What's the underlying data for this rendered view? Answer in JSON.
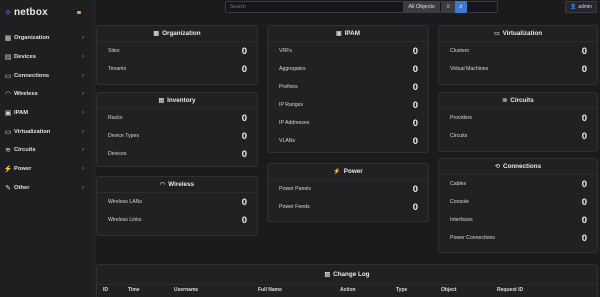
{
  "brand": {
    "name": "netbox"
  },
  "sidebar": {
    "items": [
      {
        "label": "Organization",
        "icon": "building-icon",
        "glyph": "▦"
      },
      {
        "label": "Devices",
        "icon": "server-icon",
        "glyph": "▤"
      },
      {
        "label": "Connections",
        "icon": "ethernet-icon",
        "glyph": "▭"
      },
      {
        "label": "Wireless",
        "icon": "wifi-icon",
        "glyph": "◠"
      },
      {
        "label": "IPAM",
        "icon": "counter-icon",
        "glyph": "▣"
      },
      {
        "label": "Virtualization",
        "icon": "monitor-icon",
        "glyph": "▭"
      },
      {
        "label": "Circuits",
        "icon": "transit-icon",
        "glyph": "≋"
      },
      {
        "label": "Power",
        "icon": "bolt-icon",
        "glyph": "⚡"
      },
      {
        "label": "Other",
        "icon": "notebook-icon",
        "glyph": "✎"
      }
    ]
  },
  "search": {
    "placeholder": "Search",
    "scope": "All Objects"
  },
  "user": {
    "name": "admin"
  },
  "cards": {
    "organization": {
      "title": "Organization",
      "rows": [
        {
          "label": "Sites",
          "value": "0"
        },
        {
          "label": "Tenants",
          "value": "0"
        }
      ]
    },
    "ipam": {
      "title": "IPAM",
      "rows": [
        {
          "label": "VRFs",
          "value": "0"
        },
        {
          "label": "Aggregates",
          "value": "0"
        },
        {
          "label": "Prefixes",
          "value": "0"
        },
        {
          "label": "IP Ranges",
          "value": "0"
        },
        {
          "label": "IP Addresses",
          "value": "0"
        },
        {
          "label": "VLANs",
          "value": "0"
        }
      ]
    },
    "virtualization": {
      "title": "Virtualization",
      "rows": [
        {
          "label": "Clusters",
          "value": "0"
        },
        {
          "label": "Virtual Machines",
          "value": "0"
        }
      ]
    },
    "inventory": {
      "title": "Inventory",
      "rows": [
        {
          "label": "Racks",
          "value": "0"
        },
        {
          "label": "Device Types",
          "value": "0"
        },
        {
          "label": "Devices",
          "value": "0"
        }
      ]
    },
    "circuits": {
      "title": "Circuits",
      "rows": [
        {
          "label": "Providers",
          "value": "0"
        },
        {
          "label": "Circuits",
          "value": "0"
        }
      ]
    },
    "power": {
      "title": "Power",
      "rows": [
        {
          "label": "Power Panels",
          "value": "0"
        },
        {
          "label": "Power Feeds",
          "value": "0"
        }
      ]
    },
    "connections": {
      "title": "Connections",
      "rows": [
        {
          "label": "Cables",
          "value": "0"
        },
        {
          "label": "Console",
          "value": "0"
        },
        {
          "label": "Interfaces",
          "value": "0"
        },
        {
          "label": "Power Connections",
          "value": "0"
        }
      ]
    },
    "wireless": {
      "title": "Wireless",
      "rows": [
        {
          "label": "Wireless LANs",
          "value": "0"
        },
        {
          "label": "Wireless Links",
          "value": "0"
        }
      ]
    }
  },
  "changelog": {
    "title": "Change Log",
    "columns": [
      "ID",
      "Time",
      "Username",
      "Full Name",
      "Action",
      "Type",
      "Object",
      "Request ID"
    ]
  }
}
